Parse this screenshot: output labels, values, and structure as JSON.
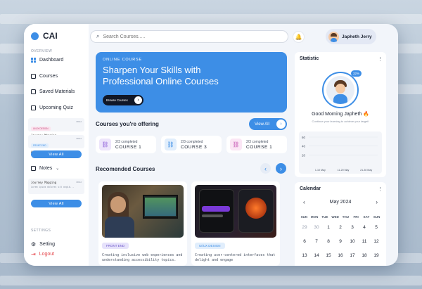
{
  "app": {
    "name": "CAI"
  },
  "sidebar": {
    "overview_label": "OVERVIEW",
    "nav": [
      {
        "label": "Dashboard",
        "icon": "grid-icon"
      },
      {
        "label": "Courses",
        "icon": "book-icon"
      },
      {
        "label": "Saved Materials",
        "icon": "bookmark-icon"
      },
      {
        "label": "Upcoming Quiz",
        "icon": "calendar-icon"
      }
    ],
    "quiz_cards": [
      {
        "tag": "UI/UX DESIGN",
        "title": "Journey Mapping",
        "date": "08/12"
      },
      {
        "tag": "FRONT END",
        "title": "HTML & CSS",
        "date": "08/12"
      }
    ],
    "quiz_view_all": "View All",
    "notes_label": "Notes",
    "note_card": {
      "title": "Journey Mapping",
      "preview": "Lorem ipsum dolores sit angib...",
      "date": "08/12"
    },
    "notes_view_all": "View All",
    "settings_section_label": "SETTINGS",
    "setting_label": "Setting",
    "logout_label": "Logout",
    "accent_color": "#3d8ee6",
    "logout_color": "#e5484d"
  },
  "header": {
    "search_placeholder": "Search Courses.....",
    "user_name": "Japheth Jerry"
  },
  "hero": {
    "kicker": "ONLINE COURSE",
    "title": "Sharpen Your Skills with Professional Online Courses",
    "button_label": "Browse Courses"
  },
  "offering": {
    "title": "Courses you're offering",
    "view_all": "View All",
    "courses": [
      {
        "progress": "2/3 completed",
        "name": "COURSE 1",
        "icon": "link-icon",
        "color": "#ede5fb",
        "ink": "#8a5ad8"
      },
      {
        "progress": "2/3 completed",
        "name": "COURSE 3",
        "icon": "link-icon",
        "color": "#e1eefc",
        "ink": "#3d8ee6"
      },
      {
        "progress": "2/3 completed",
        "name": "COURSE 1",
        "icon": "link-icon",
        "color": "#fbe6f5",
        "ink": "#c453b2"
      }
    ]
  },
  "recommended": {
    "title": "Recomended Courses",
    "courses": [
      {
        "tag": "FRONT END",
        "tag_bg": "#e6e2fb",
        "tag_ink": "#6b55c8",
        "desc": "Creating inclusive web experiences and understanding accessibility topics."
      },
      {
        "tag": "UI/UX DESIGN",
        "tag_bg": "#e1eefc",
        "tag_ink": "#3d8ee6",
        "desc": "Creating user-centered interfaces that delight and engage"
      }
    ]
  },
  "statistic": {
    "title": "Statistic",
    "badge": "32%",
    "greeting": "Good Morning Japheth 🔥",
    "subtitle": "Continue your learning to achieve your target!"
  },
  "chart_data": {
    "type": "area",
    "title": "",
    "xlabel": "",
    "ylabel": "",
    "x": [
      "1-10 May",
      "11-20 May",
      "21-30 May"
    ],
    "yticks": [
      60,
      40,
      20
    ],
    "series": []
  },
  "calendar": {
    "title": "Calendar",
    "month": "May 2024",
    "weekdays": [
      "SUN",
      "MON",
      "TUE",
      "WED",
      "THU",
      "FRI",
      "SAT",
      "SUN"
    ],
    "weeks": [
      [
        "29",
        "30",
        "1",
        "2",
        "3",
        "4",
        "5"
      ],
      [
        "6",
        "7",
        "8",
        "9",
        "10",
        "11",
        "12"
      ],
      [
        "13",
        "14",
        "15",
        "16",
        "17",
        "18",
        "19"
      ]
    ]
  }
}
